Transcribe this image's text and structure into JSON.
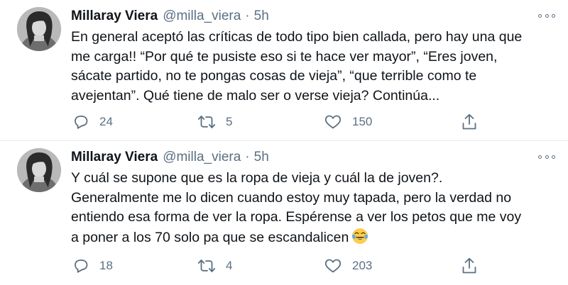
{
  "tweets": [
    {
      "author": {
        "name": "Millaray Viera",
        "handle": "@milla_viera",
        "time": "5h"
      },
      "separator": "·",
      "text_lines": [
        "En general aceptó las críticas de todo tipo bien callada, pero hay una que",
        "me carga!! “Por qué te pusiste eso si te hace ver mayor”, “Eres joven,",
        "sácate partido, no te pongas cosas de vieja”, “que terrible como te",
        "avejentan”. Qué tiene de malo ser o verse vieja? Continúa..."
      ],
      "stats": {
        "replies": "24",
        "retweets": "5",
        "likes": "150"
      }
    },
    {
      "author": {
        "name": "Millaray Viera",
        "handle": "@milla_viera",
        "time": "5h"
      },
      "separator": "·",
      "text_lines": [
        "Y cuál se supone que es la ropa de vieja y cuál la de joven?.",
        "Generalmente me lo dicen cuando estoy muy tapada, pero la verdad no",
        "entiendo esa forma de ver la ropa. Espérense a ver los petos que me voy",
        "a poner a los 70 solo pa que se escandalicen"
      ],
      "emoji": "face-with-tears-of-joy",
      "stats": {
        "replies": "18",
        "retweets": "4",
        "likes": "203"
      }
    }
  ],
  "icons": {
    "reply": "reply-icon",
    "retweet": "retweet-icon",
    "like": "like-icon",
    "share": "share-icon",
    "more": "more-options-icon"
  },
  "colors": {
    "text": "#0f1419",
    "secondary": "#5b7083",
    "divider": "#e6ecf0"
  }
}
